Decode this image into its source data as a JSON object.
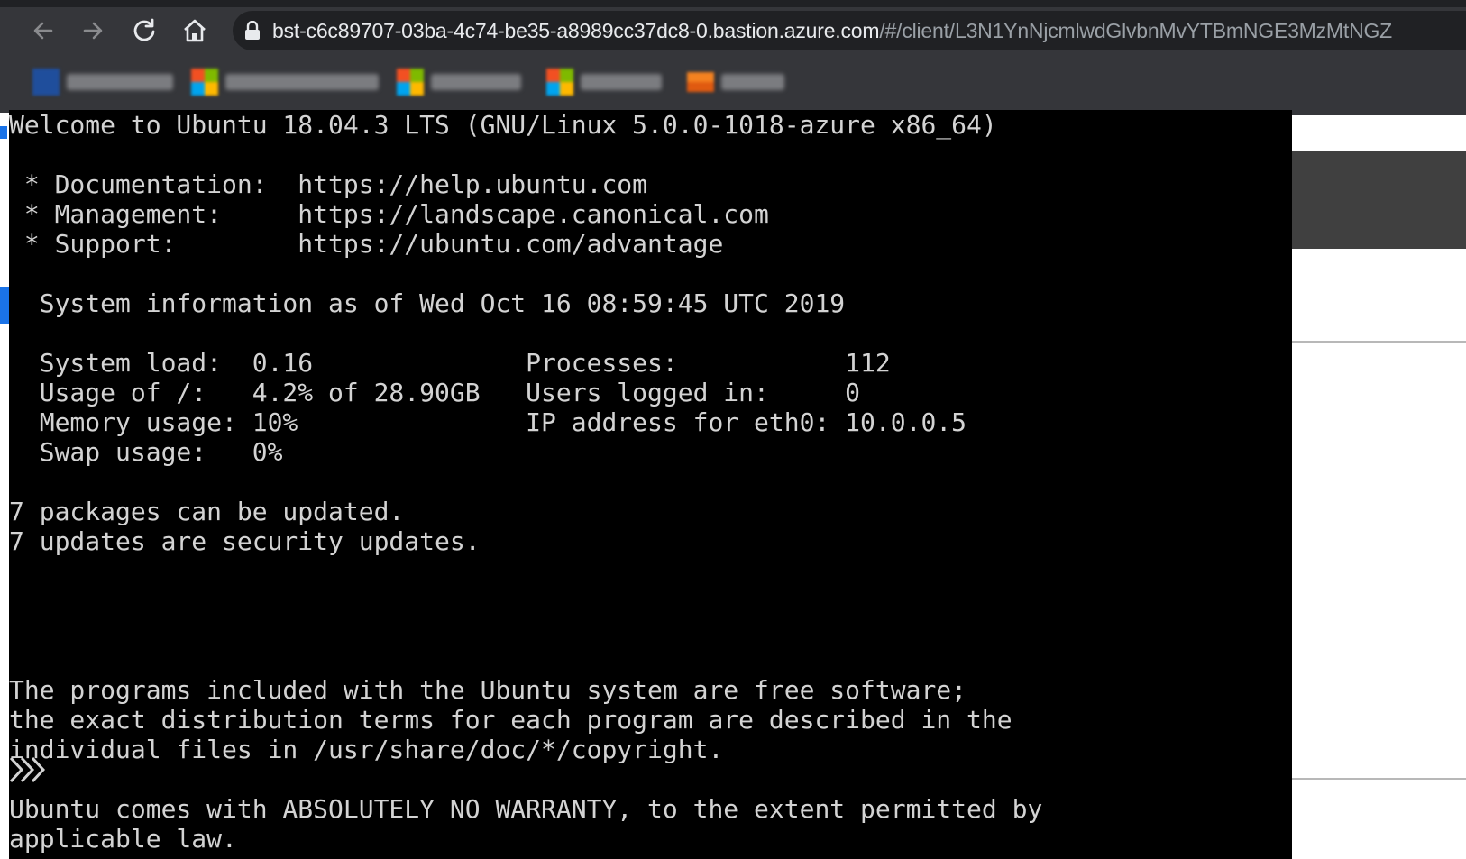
{
  "browser": {
    "url_host": "bst-c6c89707-03ba-4c74-be35-a8989cc37dc8-0.bastion.azure.com",
    "url_path": "/#/client/L3N1YnNjcmlwdGlvbnMvYTBmNGE3MzMtNGZ",
    "bookmarks": [
      {
        "colors": [
          "#1f4e9c",
          "#1f4e9c",
          "#1f4e9c",
          "#1f4e9c"
        ]
      },
      {
        "colors": [
          "#f25022",
          "#7fba00",
          "#00a4ef",
          "#ffb900"
        ]
      },
      {
        "colors": [
          "#f25022",
          "#7fba00",
          "#00a4ef",
          "#ffb900"
        ]
      },
      {
        "colors": [
          "#f25022",
          "#7fba00",
          "#00a4ef",
          "#ffb900"
        ]
      },
      {
        "colors": [
          "#f58220",
          "#f58220",
          "#e05a10",
          "#e05a10"
        ]
      }
    ]
  },
  "terminal": {
    "lines": [
      "Welcome to Ubuntu 18.04.3 LTS (GNU/Linux 5.0.0-1018-azure x86_64)",
      "",
      " * Documentation:  https://help.ubuntu.com",
      " * Management:     https://landscape.canonical.com",
      " * Support:        https://ubuntu.com/advantage",
      "",
      "  System information as of Wed Oct 16 08:59:45 UTC 2019",
      "",
      "  System load:  0.16              Processes:           112",
      "  Usage of /:   4.2% of 28.90GB   Users logged in:     0",
      "  Memory usage: 10%               IP address for eth0: 10.0.0.5",
      "  Swap usage:   0%",
      "",
      "7 packages can be updated.",
      "7 updates are security updates.",
      "",
      "",
      "",
      "",
      "The programs included with the Ubuntu system are free software;",
      "the exact distribution terms for each program are described in the",
      "individual files in /usr/share/doc/*/copyright.",
      "",
      "Ubuntu comes with ABSOLUTELY NO WARRANTY, to the extent permitted by",
      "applicable law."
    ]
  }
}
